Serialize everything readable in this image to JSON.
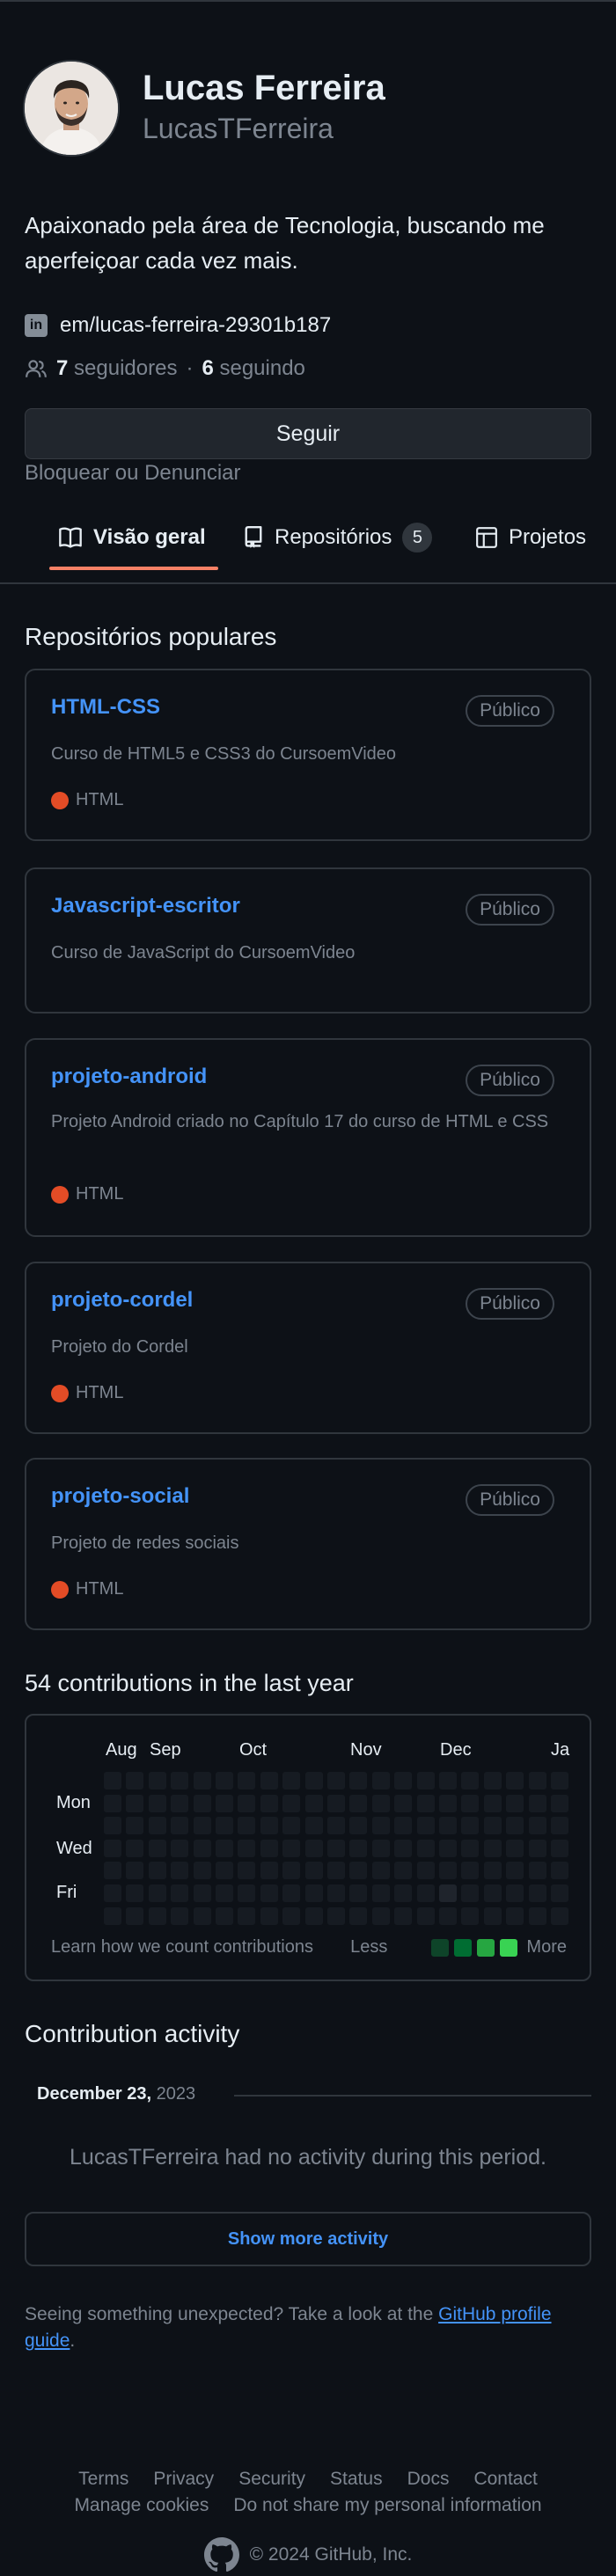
{
  "profile": {
    "name": "Lucas Ferreira",
    "login": "LucasTFerreira",
    "bio": "Apaixonado pela área de Tecnologia, buscando me aperfeiçoar cada vez mais.",
    "linkedin": "em/lucas-ferreira-29301b187",
    "followers_count": "7",
    "followers_label": "seguidores",
    "separator": "·",
    "following_count": "6",
    "following_label": "seguindo",
    "follow_button": "Seguir",
    "block_link": "Bloquear ou Denunciar"
  },
  "tabs": [
    {
      "label": "Visão geral",
      "icon": "book-icon",
      "active": true
    },
    {
      "label": "Repositórios",
      "icon": "repo-icon",
      "counter": "5"
    },
    {
      "label": "Projetos",
      "icon": "table-icon"
    }
  ],
  "popular": {
    "title": "Repositórios populares",
    "repos": [
      {
        "name": "HTML-CSS",
        "visibility": "Público",
        "description": "Curso de HTML5 e CSS3 do CursoemVideo",
        "language": "HTML"
      },
      {
        "name": "Javascript-escritor",
        "visibility": "Público",
        "description": "Curso de JavaScript do CursoemVideo",
        "language": ""
      },
      {
        "name": "projeto-android",
        "visibility": "Público",
        "description": "Projeto Android criado no Capítulo 17 do curso de HTML e CSS",
        "language": "HTML"
      },
      {
        "name": "projeto-cordel",
        "visibility": "Público",
        "description": "Projeto do Cordel",
        "language": "HTML"
      },
      {
        "name": "projeto-social",
        "visibility": "Público",
        "description": "Projeto de redes sociais",
        "language": "HTML"
      }
    ],
    "language_color": "#e34c26"
  },
  "contributions": {
    "title": "54 contributions in the last year",
    "months": [
      "Aug",
      "Sep",
      "Oct",
      "Nov",
      "Dec",
      "Ja"
    ],
    "days": [
      "Mon",
      "Wed",
      "Fri"
    ],
    "learn_link": "Learn how we count contributions",
    "legend_less": "Less",
    "legend_more": "More",
    "colors": [
      "#161b22",
      "#0e4429",
      "#006d32",
      "#26a641",
      "#39d353"
    ]
  },
  "activity": {
    "title": "Contribution activity",
    "date_month_day": "December 23,",
    "date_year": "2023",
    "no_activity": "LucasTFerreira had no activity during this period.",
    "show_more": "Show more activity",
    "unexpected_text": "Seeing something unexpected? Take a look at the ",
    "unexpected_link": "GitHub profile guide",
    "unexpected_end": "."
  },
  "footer": {
    "links_row1": [
      "Terms",
      "Privacy",
      "Security",
      "Status",
      "Docs",
      "Contact"
    ],
    "links_row2": [
      "Manage cookies",
      "Do not share my personal information"
    ],
    "copyright": "© 2024 GitHub, Inc."
  }
}
